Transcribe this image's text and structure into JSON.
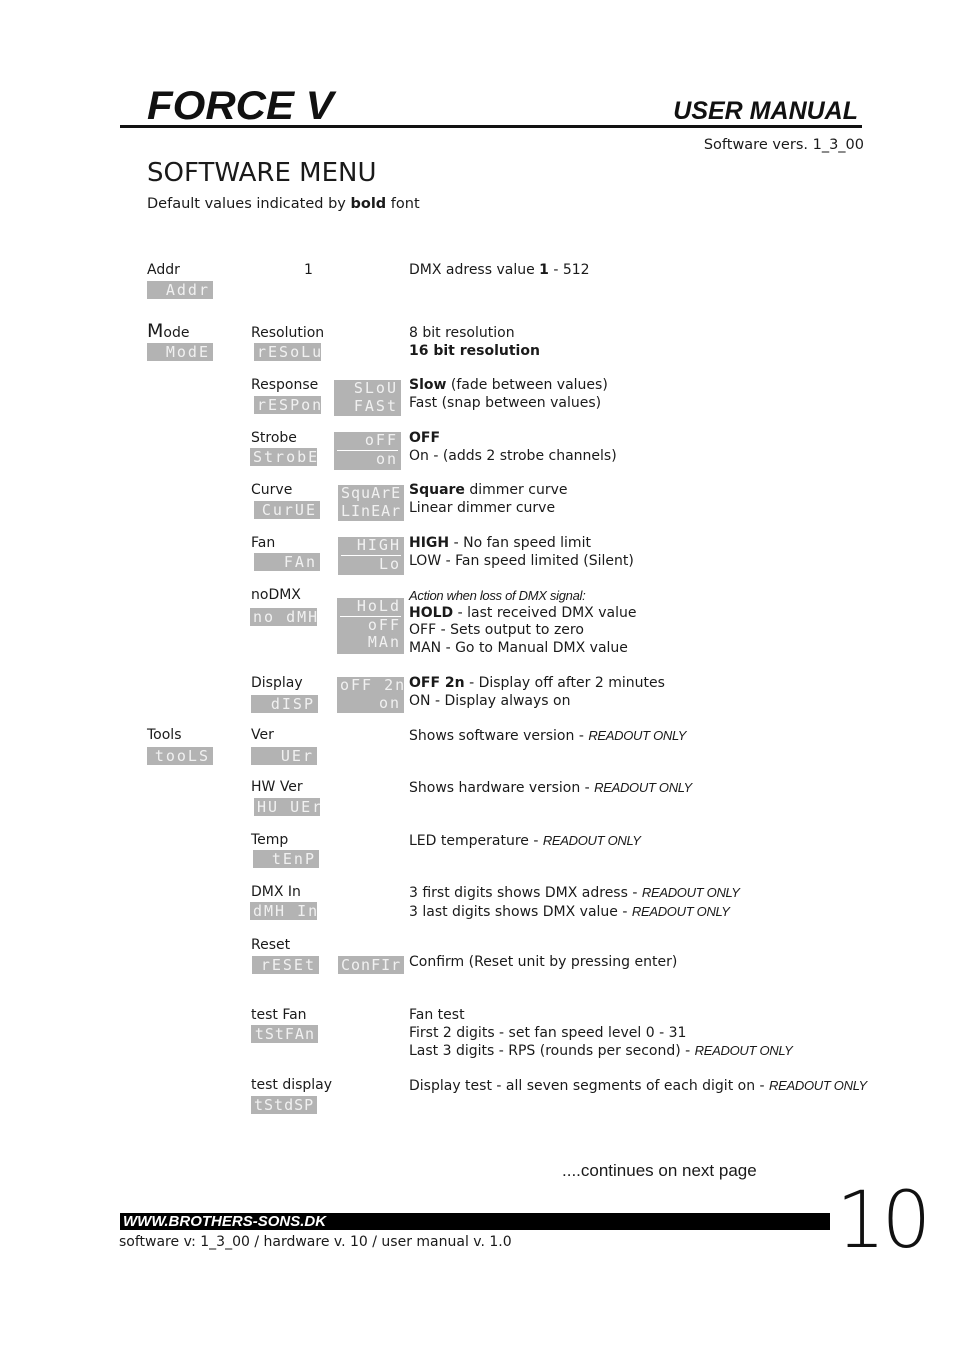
{
  "header": {
    "brand": "FORCE V",
    "doc_type": "USER MANUAL",
    "software_version": "Software vers. 1_3_00"
  },
  "section": {
    "title": "SOFTWARE MENU",
    "subtitle_pre": "Default values indicated by ",
    "subtitle_bold": "bold",
    "subtitle_post": " font"
  },
  "menu": {
    "addr": {
      "label": "Addr",
      "lcd": "Addr",
      "value": "1",
      "desc_pre": "DMX adress value ",
      "desc_bold": "1",
      "desc_post": " - 512"
    },
    "mode": {
      "label": "Mode",
      "lcd": "ModE",
      "resolution": {
        "label": "Resolution",
        "lcd": "rESoLu",
        "opt1": "8 bit resolution",
        "opt2_bold": "16 bit resolution"
      },
      "response": {
        "label": "Response",
        "lcd": "rESPon",
        "lcd_opt1": "SLoU",
        "lcd_opt2": "FASt",
        "opt1_bold": "Slow",
        "opt1_rest": " (fade between values)",
        "opt2": "Fast (snap between values)"
      },
      "strobe": {
        "label": "Strobe",
        "lcd": "StrobE",
        "lcd_opt1": "oFF",
        "lcd_opt2": "on",
        "opt1_bold": "OFF",
        "opt2": "On - (adds 2 strobe channels)"
      },
      "curve": {
        "label": "Curve",
        "lcd": "CurUE",
        "lcd_opt1": "SquArE",
        "lcd_opt2": "LInEAr",
        "opt1_bold": "Square",
        "opt1_rest": " dimmer curve",
        "opt2": "Linear dimmer curve"
      },
      "fan": {
        "label": "Fan",
        "lcd": "FAn",
        "lcd_opt1": "HIGH",
        "lcd_opt2": "Lo",
        "opt1_bold": "HIGH",
        "opt1_rest": " - No fan speed limit",
        "opt2": "LOW - Fan speed limited (Silent)"
      },
      "nodmx": {
        "label": "noDMX",
        "lcd": "no dMH",
        "lcd_opt1": "HoLd",
        "lcd_opt2": "oFF",
        "lcd_opt3": "MAn",
        "note": "Action when loss of DMX signal:",
        "opt1_bold": "HOLD",
        "opt1_rest": " - last received DMX value",
        "opt2": "OFF - Sets output to zero",
        "opt3": "MAN - Go to Manual DMX value"
      },
      "display": {
        "label": "Display",
        "lcd": "dISP",
        "lcd_opt1": "oFF 2n",
        "lcd_opt2": "on",
        "opt1_bold": "OFF 2n",
        "opt1_rest": " - Display off after 2 minutes",
        "opt2": "ON - Display always on"
      }
    },
    "tools": {
      "label": "Tools",
      "lcd": "tooLS",
      "ver": {
        "label": "Ver",
        "lcd": "UEr",
        "desc": "Shows software version - ",
        "ro": "READOUT ONLY"
      },
      "hwver": {
        "label": "HW Ver",
        "lcd": "HU UEr",
        "desc": "Shows hardware version - ",
        "ro": "READOUT ONLY"
      },
      "temp": {
        "label": "Temp",
        "lcd": "tEnP",
        "desc": "LED temperature - ",
        "ro": "READOUT ONLY"
      },
      "dmxin": {
        "label": "DMX In",
        "lcd": "dMH In",
        "desc1": "3 first digits shows DMX adress - ",
        "ro1": "READOUT ONLY",
        "desc2": "3 last digits shows DMX value - ",
        "ro2": "READOUT ONLY"
      },
      "reset": {
        "label": "Reset",
        "lcd": "rESEt",
        "lcd_opt1": "ConFIr",
        "desc": "Confirm (Reset unit by pressing enter)"
      },
      "testfan": {
        "label": "test Fan",
        "lcd": "tStFAn",
        "desc1": "Fan test",
        "desc2": "First 2 digits - set fan speed level 0 - 31",
        "desc3": "Last 3 digits - RPS (rounds per second) - ",
        "ro3": "READOUT ONLY"
      },
      "testdisplay": {
        "label": "test display",
        "lcd": "tStdSP",
        "desc": "Display test - all seven segments of each digit on - ",
        "ro": "READOUT ONLY"
      }
    }
  },
  "footer": {
    "continues": "....continues on next page",
    "url": "WWW.BROTHERS-SONS.DK",
    "versions": "software v: 1_3_00  /  hardware v. 10  /  user manual v. 1.0",
    "page_number": "10"
  }
}
